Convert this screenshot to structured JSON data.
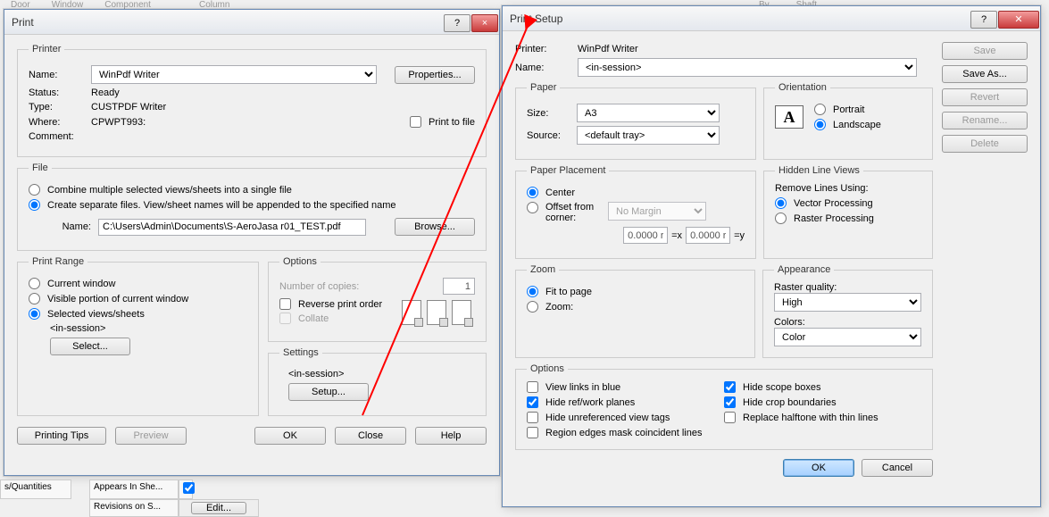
{
  "background_menus": [
    "Door",
    "Window",
    "Component",
    "Column",
    "By",
    "Shaft"
  ],
  "print": {
    "title": "Print",
    "printer": {
      "legend": "Printer",
      "name_label": "Name:",
      "name_value": "WinPdf Writer",
      "properties_btn": "Properties...",
      "status_label": "Status:",
      "status_value": "Ready",
      "type_label": "Type:",
      "type_value": "CUSTPDF Writer",
      "where_label": "Where:",
      "where_value": "CPWPT993:",
      "comment_label": "Comment:",
      "print_to_file": "Print to file"
    },
    "file": {
      "legend": "File",
      "combine": "Combine multiple selected views/sheets into a single file",
      "separate": "Create separate files. View/sheet names will be appended to the specified name",
      "name_label": "Name:",
      "path": "C:\\Users\\Admin\\Documents\\S-AeroJasa r01_TEST.pdf",
      "browse_btn": "Browse..."
    },
    "range": {
      "legend": "Print Range",
      "current": "Current window",
      "visible": "Visible portion of current window",
      "selected": "Selected views/sheets",
      "session": "<in-session>",
      "select_btn": "Select..."
    },
    "options": {
      "legend": "Options",
      "copies_label": "Number of copies:",
      "copies": "1",
      "reverse": "Reverse print order",
      "collate": "Collate"
    },
    "settings": {
      "legend": "Settings",
      "session": "<in-session>",
      "setup_btn": "Setup..."
    },
    "buttons": {
      "tips": "Printing Tips",
      "preview": "Preview",
      "ok": "OK",
      "close": "Close",
      "help": "Help"
    }
  },
  "setup": {
    "title": "Print Setup",
    "printer_label": "Printer:",
    "printer_value": "WinPdf Writer",
    "name_label": "Name:",
    "name_value": "<in-session>",
    "side_buttons": {
      "save": "Save",
      "save_as": "Save As...",
      "revert": "Revert",
      "rename": "Rename...",
      "delete": "Delete"
    },
    "paper": {
      "legend": "Paper",
      "size_label": "Size:",
      "size_value": "A3",
      "source_label": "Source:",
      "source_value": "<default tray>"
    },
    "orientation": {
      "legend": "Orientation",
      "portrait": "Portrait",
      "landscape": "Landscape"
    },
    "placement": {
      "legend": "Paper Placement",
      "center": "Center",
      "offset": "Offset from corner:",
      "margin": "No Margin",
      "x": "0.0000 r",
      "y": "0.0000 r",
      "eqx": "=x",
      "eqy": "=y"
    },
    "hidden": {
      "legend": "Hidden Line Views",
      "remove_label": "Remove Lines Using:",
      "vector": "Vector Processing",
      "raster": "Raster Processing"
    },
    "zoom": {
      "legend": "Zoom",
      "fit": "Fit to page",
      "zoom": "Zoom:"
    },
    "appearance": {
      "legend": "Appearance",
      "raster_label": "Raster quality:",
      "raster_value": "High",
      "colors_label": "Colors:",
      "colors_value": "Color"
    },
    "options": {
      "legend": "Options",
      "links": "View links in blue",
      "scope": "Hide scope boxes",
      "planes": "Hide ref/work planes",
      "crop": "Hide crop boundaries",
      "unref": "Hide unreferenced view tags",
      "halftone": "Replace halftone with thin lines",
      "regions": "Region edges mask coincident lines"
    },
    "ok": "OK",
    "cancel": "Cancel"
  },
  "props": {
    "quantities": "s/Quantities",
    "appears": "Appears In She...",
    "revisions": "Revisions on S...",
    "edit": "Edit..."
  }
}
